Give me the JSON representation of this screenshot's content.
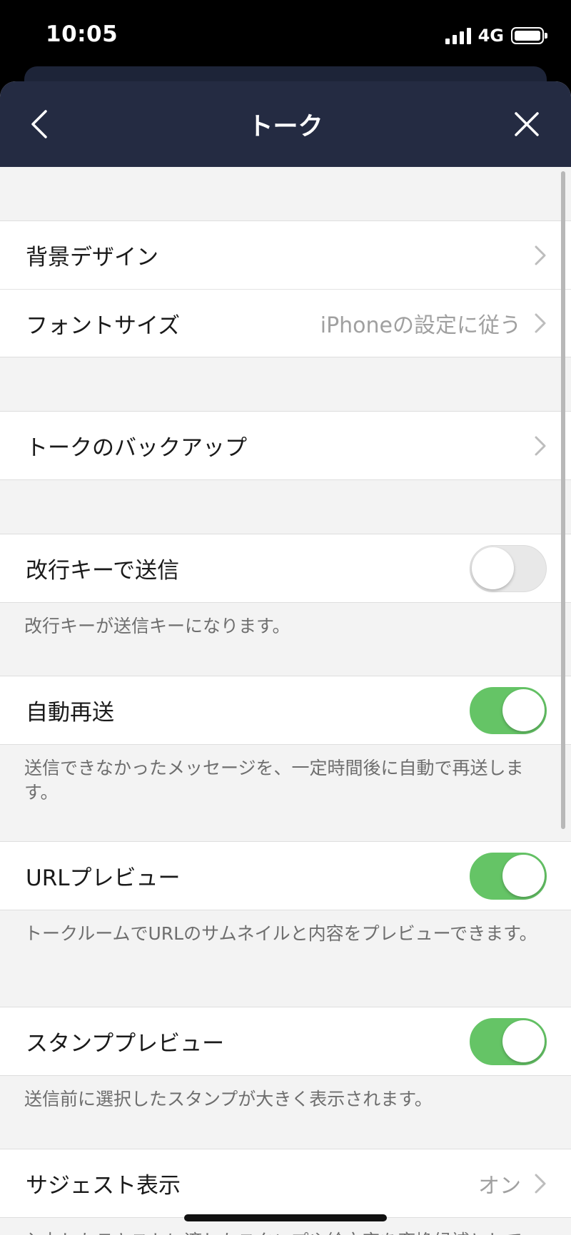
{
  "status": {
    "time": "10:05",
    "network": "4G"
  },
  "nav": {
    "title": "トーク"
  },
  "settings": {
    "background_design": "背景デザイン",
    "font_size": {
      "label": "フォントサイズ",
      "value": "iPhoneの設定に従う"
    },
    "talk_backup": "トークのバックアップ",
    "enter_send": {
      "label": "改行キーで送信",
      "enabled": false,
      "desc": "改行キーが送信キーになります。"
    },
    "auto_resend": {
      "label": "自動再送",
      "enabled": true,
      "desc": "送信できなかったメッセージを、一定時間後に自動で再送します。"
    },
    "url_preview": {
      "label": "URLプレビュー",
      "enabled": true,
      "desc": "トークルームでURLのサムネイルと内容をプレビューできます。"
    },
    "sticker_preview": {
      "label": "スタンププレビュー",
      "enabled": true,
      "desc": "送信前に選択したスタンプが大きく表示されます。"
    },
    "suggest": {
      "label": "サジェスト表示",
      "value": "オン",
      "desc": "入力したテキストに適したスタンプや絵文字を変換候補として"
    }
  },
  "colors": {
    "nav_bg": "#242b42",
    "toggle_on": "#65c466",
    "page_bg": "#f3f3f3"
  },
  "icons": {
    "back": "chevron-left-icon",
    "close": "close-icon",
    "row": "chevron-right-icon"
  }
}
